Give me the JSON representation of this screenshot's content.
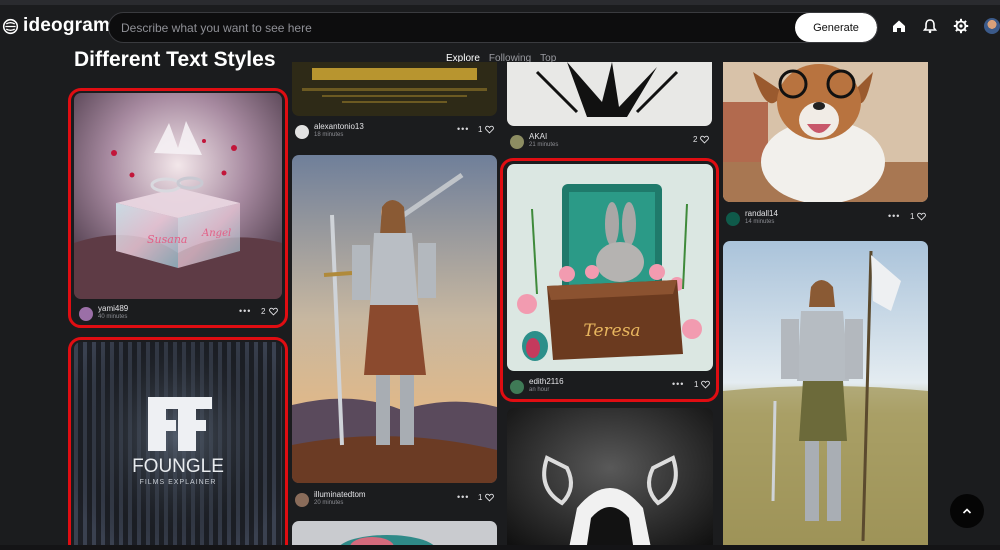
{
  "app": {
    "logo_text": "ideogram",
    "logo_icon": "ideogram-logo-icon"
  },
  "search": {
    "placeholder": "Describe what you want to see here",
    "value": ""
  },
  "header": {
    "generate_label": "Generate",
    "icons": [
      "home-icon",
      "bell-icon",
      "gear-icon",
      "user-avatar"
    ]
  },
  "page": {
    "title": "Different Text Styles"
  },
  "tabs": [
    {
      "label": "Explore",
      "active": true
    },
    {
      "label": "Following",
      "active": false
    },
    {
      "label": "Top",
      "active": false
    }
  ],
  "cards": {
    "wedding_box": {
      "user": "yami489",
      "time": "40 minutes",
      "likes": "2",
      "image_text": [
        "Susana",
        "Angel"
      ]
    },
    "foungle": {
      "image_text": [
        "FOUNGLE",
        "FILMS EXPLAINER"
      ]
    },
    "movie_poster": {
      "user": "alexantonio13",
      "time": "18 minutes",
      "likes": "1"
    },
    "knight_woman": {
      "user": "illuminatedtom",
      "time": "20 minutes",
      "likes": "1"
    },
    "black_ink": {
      "user": "AKAI",
      "time": "21 minutes",
      "likes": "2"
    },
    "bunny_box": {
      "user": "edith2116",
      "time": "an hour",
      "likes": "1",
      "image_text": "Teresa"
    },
    "dog": {
      "user": "randall14",
      "time": "14 minutes",
      "likes": "1"
    }
  },
  "colors": {
    "highlight": "#e00d12",
    "background": "#1b1c1e",
    "generate_bg": "#ffffff"
  }
}
